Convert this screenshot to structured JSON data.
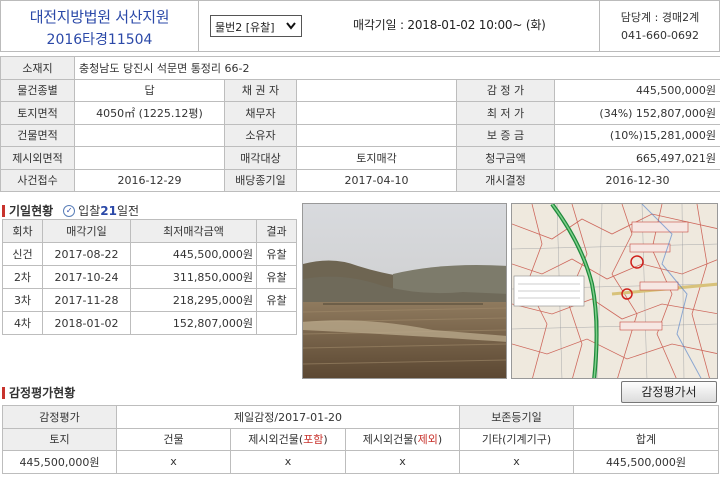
{
  "header": {
    "court_name": "대전지방법원 서산지원",
    "case_number": "2016타경11504",
    "item_select": "물번2 [유찰]",
    "sale_date_label": "매각기일 : 2018-01-02   10:00~ (화)",
    "contact_team": "담당계 : 경매2계",
    "contact_phone": "041-660-0692"
  },
  "info": {
    "location_label": "소재지",
    "location_value": "충청남도 당진시 석문면 통정리 66-2",
    "row1": {
      "l1": "물건종별",
      "v1": "답",
      "l2": "채 권 자",
      "v2": "",
      "l3": "감 정 가",
      "v3": "445,500,000원"
    },
    "row2": {
      "l1": "토지면적",
      "v1": "4050㎡ (1225.12평)",
      "l2": "채무자",
      "v2": "",
      "l3": "최 저 가",
      "v3": "(34%) 152,807,000원"
    },
    "row3": {
      "l1": "건물면적",
      "v1": "",
      "l2": "소유자",
      "v2": "",
      "l3": "보 증 금",
      "v3": "(10%)15,281,000원"
    },
    "row4": {
      "l1": "제시외면적",
      "v1": "",
      "l2": "매각대상",
      "v2": "토지매각",
      "l3": "청구금액",
      "v3": "665,497,021원"
    },
    "row5": {
      "l1": "사건접수",
      "v1": "2016-12-29",
      "l2": "배당종기일",
      "v2": "2017-04-10",
      "l3": "개시결정",
      "v3": "2016-12-30"
    }
  },
  "bidding": {
    "title": "기일현황",
    "check_prefix": "입찰",
    "check_number": "21",
    "check_suffix": "일전",
    "headers": [
      "회차",
      "매각기일",
      "최저매각금액",
      "결과"
    ],
    "rows": [
      {
        "round": "신건",
        "date": "2017-08-22",
        "price": "445,500,000원",
        "result": "유찰"
      },
      {
        "round": "2차",
        "date": "2017-10-24",
        "price": "311,850,000원",
        "result": "유찰"
      },
      {
        "round": "3차",
        "date": "2017-11-28",
        "price": "218,295,000원",
        "result": "유찰"
      },
      {
        "round": "4차",
        "date": "2018-01-02",
        "price": "152,807,000원",
        "result": ""
      }
    ]
  },
  "appraisal": {
    "title": "감정평가현황",
    "button": "감정평가서",
    "head_label": "감정평가",
    "head_value": "제일감정/2017-01-20",
    "head_label2": "보존등기일",
    "head_value2": "",
    "cols": {
      "land": "토지",
      "building": "건물",
      "extra_inc_prefix": "제시외건물(",
      "extra_inc_hl": "포함",
      "extra_exc_prefix": "제시외건물(",
      "extra_exc_hl": "제외",
      "close": ")",
      "other": "기타(기계기구)",
      "total": "합계"
    },
    "values": {
      "land": "445,500,000원",
      "building": "x",
      "extra_inc": "x",
      "extra_exc": "x",
      "other": "x",
      "total": "445,500,000원"
    }
  },
  "colors": {
    "accent_blue": "#2b49a8",
    "accent_red": "#c8332d",
    "label_bg": "#eeeeee"
  }
}
